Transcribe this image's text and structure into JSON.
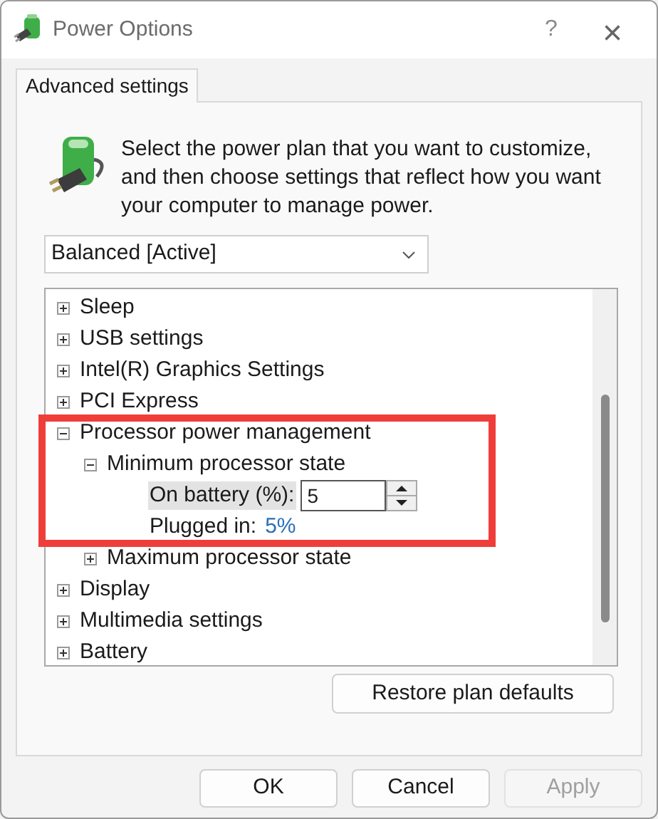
{
  "window": {
    "title": "Power Options",
    "help": "?",
    "close": "×"
  },
  "tabs": [
    {
      "label": "Advanced settings",
      "selected": true
    }
  ],
  "description": "Select the power plan that you want to customize, and then choose settings that reflect how you want your computer to manage power.",
  "plan_dropdown": {
    "value": "Balanced [Active]"
  },
  "tree": [
    {
      "label": "Sleep",
      "expanded": false
    },
    {
      "label": "USB settings",
      "expanded": false
    },
    {
      "label": "Intel(R) Graphics Settings",
      "expanded": false
    },
    {
      "label": "PCI Express",
      "expanded": false
    },
    {
      "label": "Processor power management",
      "expanded": true,
      "children": [
        {
          "label": "Minimum processor state",
          "expanded": true,
          "settings": [
            {
              "kind": "spin",
              "label": "On battery (%):",
              "value": "5",
              "selected": true
            },
            {
              "kind": "link",
              "label": "Plugged in:",
              "value": "5%",
              "selected": false
            }
          ]
        },
        {
          "label": "Maximum processor state",
          "expanded": false
        }
      ]
    },
    {
      "label": "Display",
      "expanded": false
    },
    {
      "label": "Multimedia settings",
      "expanded": false
    },
    {
      "label": "Battery",
      "expanded": false
    }
  ],
  "restore_button": "Restore plan defaults",
  "buttons": [
    {
      "label": "OK",
      "disabled": false
    },
    {
      "label": "Cancel",
      "disabled": false
    },
    {
      "label": "Apply",
      "disabled": true
    }
  ]
}
